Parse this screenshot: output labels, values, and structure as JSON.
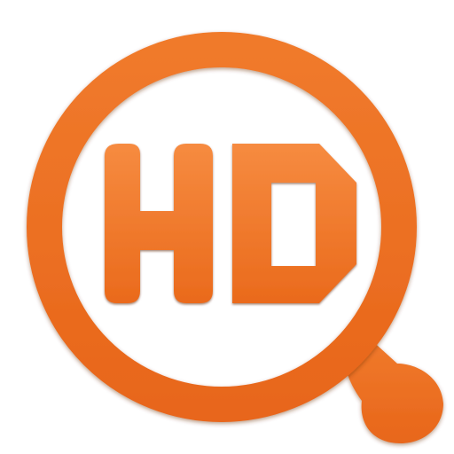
{
  "icon": {
    "name": "hd-magnifier-app-icon",
    "logo_text": "HD",
    "colors": {
      "ring": "#ED6A1A",
      "letters_top": "#F68B40",
      "letters_bottom": "#EA6A1C",
      "shadow": "#8A3A08",
      "background": "#FFFFFF"
    }
  }
}
